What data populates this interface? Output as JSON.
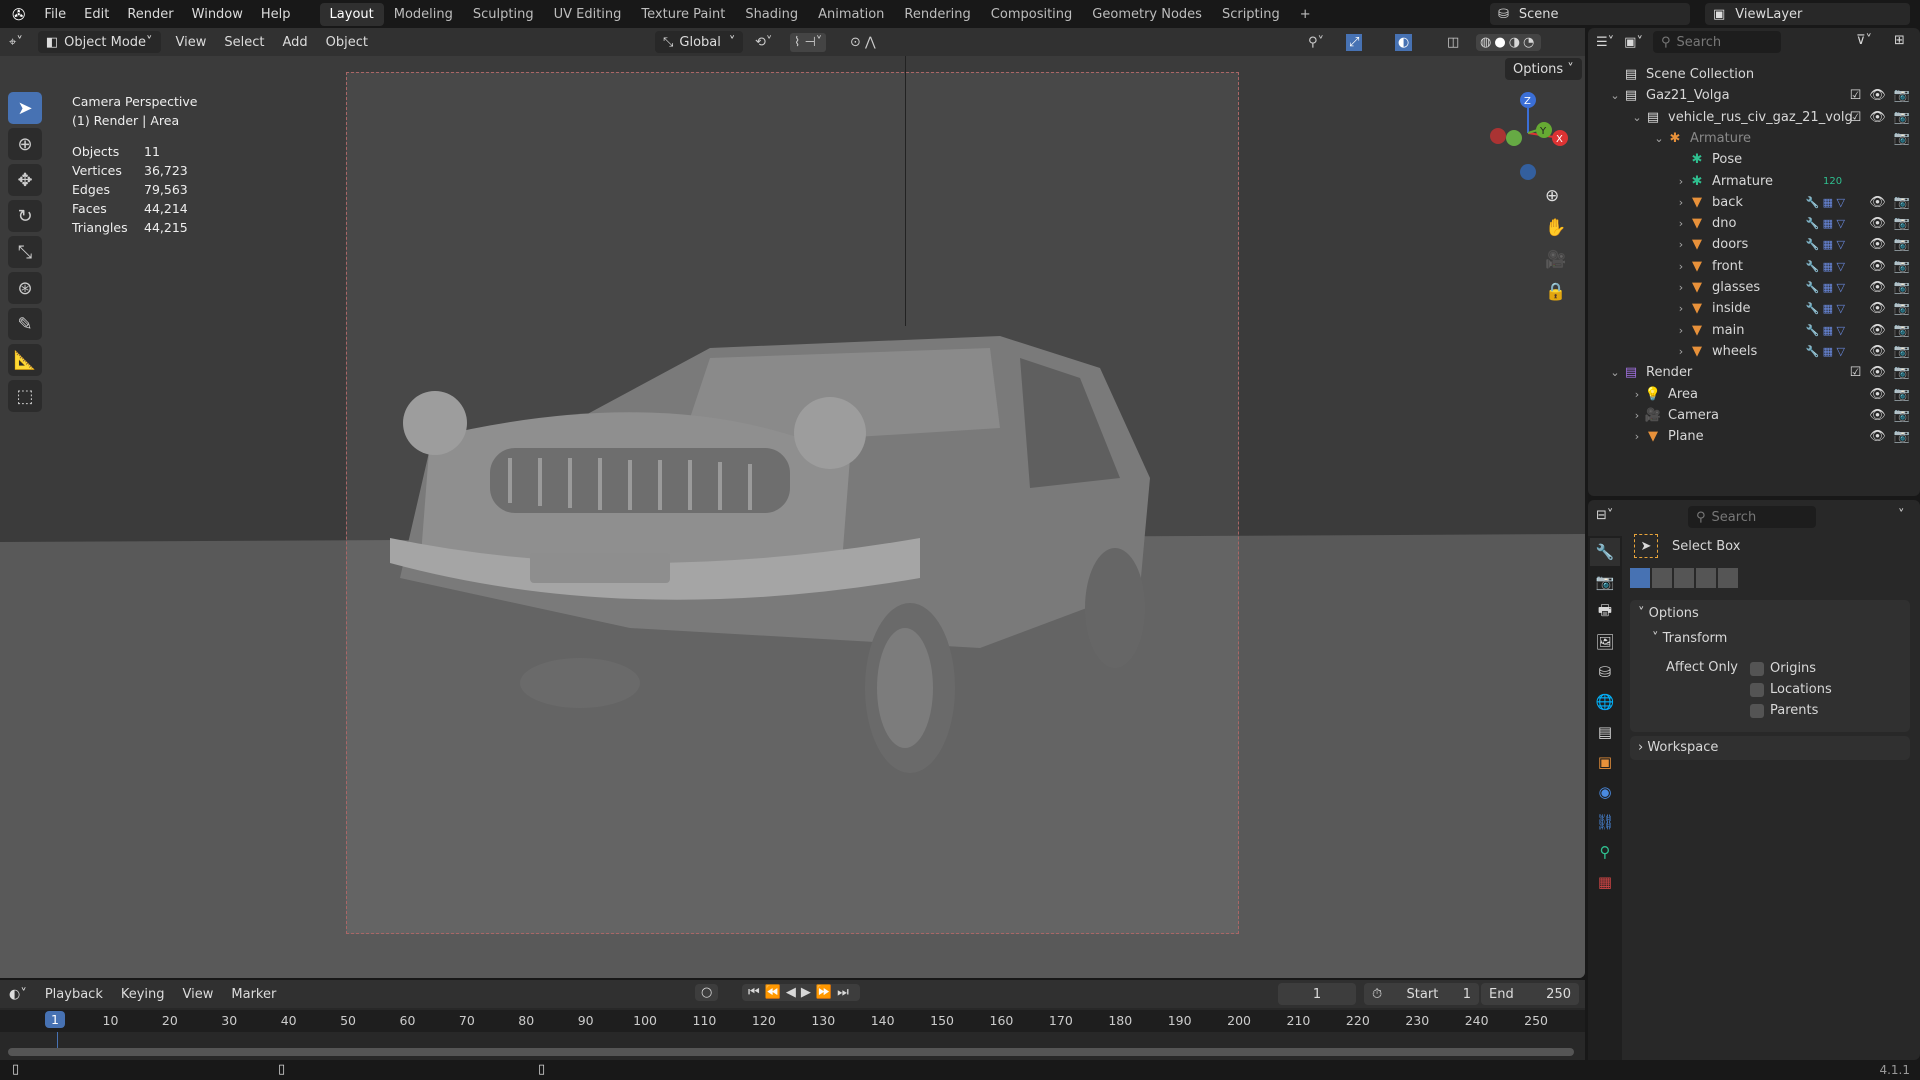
{
  "topbar": {
    "menus": [
      "File",
      "Edit",
      "Render",
      "Window",
      "Help"
    ],
    "workspaces": [
      "Layout",
      "Modeling",
      "Sculpting",
      "UV Editing",
      "Texture Paint",
      "Shading",
      "Animation",
      "Rendering",
      "Compositing",
      "Geometry Nodes",
      "Scripting"
    ],
    "active_workspace": "Layout",
    "add_tab": "+",
    "scene": "Scene",
    "view_layer": "ViewLayer"
  },
  "viewport": {
    "mode": "Object Mode",
    "menus": [
      "View",
      "Select",
      "Add",
      "Object"
    ],
    "orientation": "Global",
    "options": "Options",
    "overlay": {
      "title": "Camera Perspective",
      "subtitle": "(1) Render | Area",
      "stats": [
        {
          "k": "Objects",
          "v": "11"
        },
        {
          "k": "Vertices",
          "v": "36,723"
        },
        {
          "k": "Edges",
          "v": "79,563"
        },
        {
          "k": "Faces",
          "v": "44,214"
        },
        {
          "k": "Triangles",
          "v": "44,215"
        }
      ]
    },
    "gizmo": {
      "z": "Z",
      "y": "Y",
      "x": "X"
    }
  },
  "outliner": {
    "search_placeholder": "Search",
    "rows": [
      {
        "label": "Scene Collection",
        "depth": 0,
        "icon": "scene-collection-icon",
        "chev": ""
      },
      {
        "label": "Gaz21_Volga",
        "depth": 0,
        "icon": "collection-icon",
        "chev": "v",
        "check": true,
        "vis": true
      },
      {
        "label": "vehicle_rus_civ_gaz_21_volg",
        "depth": 1,
        "icon": "collection-icon",
        "chev": "v",
        "check": true,
        "vis": true
      },
      {
        "label": "Armature",
        "depth": 2,
        "icon": "armature-icon",
        "chev": "v",
        "dim": true,
        "camonly": true
      },
      {
        "label": "Pose",
        "depth": 3,
        "icon": "pose-icon",
        "chev": ""
      },
      {
        "label": "Armature",
        "depth": 3,
        "icon": "armature-data-icon",
        "chev": ">",
        "extra": "120"
      },
      {
        "label": "back",
        "depth": 3,
        "icon": "mesh-icon",
        "chev": ">",
        "vis": true
      },
      {
        "label": "dno",
        "depth": 3,
        "icon": "mesh-icon",
        "chev": ">",
        "vis": true
      },
      {
        "label": "doors",
        "depth": 3,
        "icon": "mesh-icon",
        "chev": ">",
        "vis": true
      },
      {
        "label": "front",
        "depth": 3,
        "icon": "mesh-icon",
        "chev": ">",
        "vis": true
      },
      {
        "label": "glasses",
        "depth": 3,
        "icon": "mesh-icon",
        "chev": ">",
        "vis": true
      },
      {
        "label": "inside",
        "depth": 3,
        "icon": "mesh-icon",
        "chev": ">",
        "vis": true
      },
      {
        "label": "main",
        "depth": 3,
        "icon": "mesh-icon",
        "chev": ">",
        "vis": true
      },
      {
        "label": "wheels",
        "depth": 3,
        "icon": "mesh-icon",
        "chev": ">",
        "vis": true
      },
      {
        "label": "Render",
        "depth": 0,
        "icon": "render-collection-icon",
        "chev": "v",
        "check": true,
        "vis": true
      },
      {
        "label": "Area",
        "depth": 1,
        "icon": "light-icon",
        "chev": ">",
        "vis": true
      },
      {
        "label": "Camera",
        "depth": 1,
        "icon": "camera-icon",
        "chev": ">",
        "vis": true
      },
      {
        "label": "Plane",
        "depth": 1,
        "icon": "mesh-icon",
        "chev": ">",
        "vis": true
      }
    ]
  },
  "properties": {
    "search_placeholder": "Search",
    "tool": "Select Box",
    "options": "Options",
    "transform": "Transform",
    "affect_only": "Affect Only",
    "checks": [
      "Origins",
      "Locations",
      "Parents"
    ],
    "workspace": "Workspace"
  },
  "timeline": {
    "menus": [
      "Playback",
      "Keying",
      "View",
      "Marker"
    ],
    "current_frame": "1",
    "start_label": "Start",
    "start": "1",
    "end_label": "End",
    "end": "250",
    "ticks": [
      "10",
      "20",
      "30",
      "40",
      "50",
      "60",
      "70",
      "80",
      "90",
      "100",
      "110",
      "120",
      "130",
      "140",
      "150",
      "160",
      "170",
      "180",
      "190",
      "200",
      "210",
      "220",
      "230",
      "240",
      "250"
    ]
  },
  "status": {
    "version": "4.1.1"
  },
  "colors": {
    "accent": "#4772b3",
    "mesh": "#e8913a",
    "green": "#2fbf8f"
  }
}
